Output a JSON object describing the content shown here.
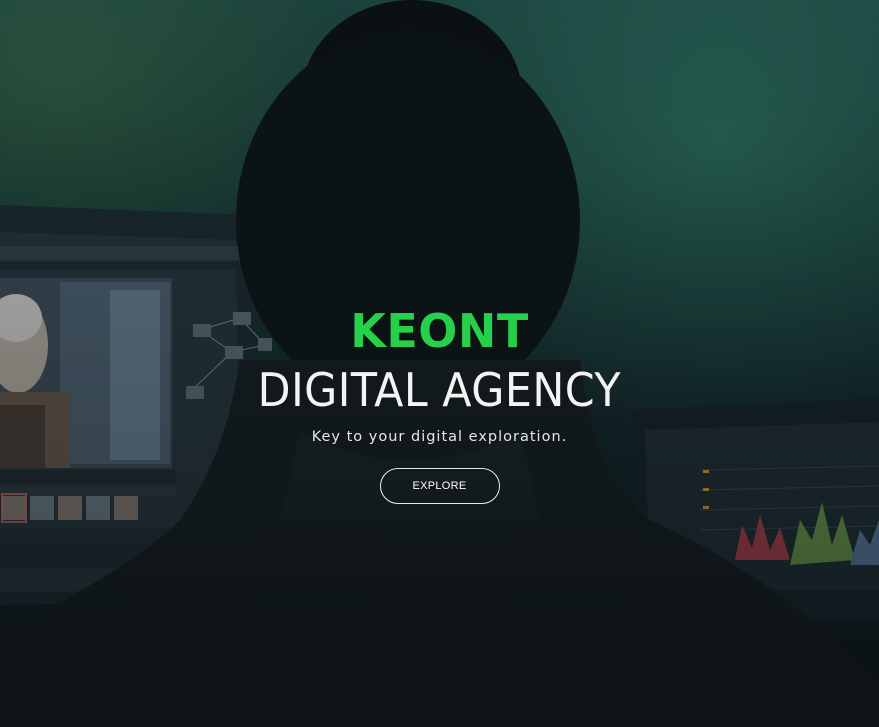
{
  "hero": {
    "brand": "KEONT",
    "tagline": "DIGITAL AGENCY",
    "subtitle": "Key to your digital exploration.",
    "cta_label": "EXPLORE"
  },
  "colors": {
    "brand_green": "#27d04a",
    "text_white": "#ffffff",
    "background_teal": "#1f4a44"
  },
  "icons": []
}
